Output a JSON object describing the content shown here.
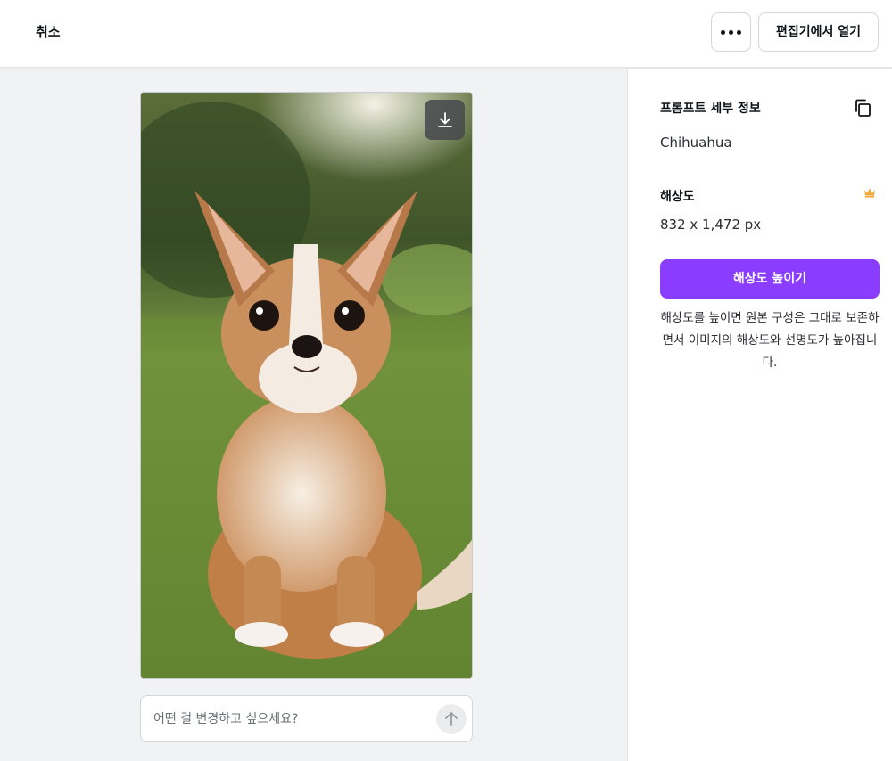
{
  "topbar": {
    "cancel_label": "취소",
    "more_icon": "more-horizontal-icon",
    "open_editor_label": "편집기에서 열기"
  },
  "canvas": {
    "image_subject": "Chihuahua",
    "download_icon": "download-icon",
    "prompt": {
      "placeholder": "어떤 걸 변경하고 싶으세요?",
      "value": "",
      "send_icon": "arrow-up-icon"
    }
  },
  "panel": {
    "prompt_details_title": "프롬프트 세부 정보",
    "prompt_text": "Chihuahua",
    "copy_icon": "copy-icon",
    "resolution_title": "해상도",
    "resolution_value": "832 x 1,472 px",
    "premium_icon": "crown-icon",
    "upscale_button_label": "해상도 높이기",
    "upscale_description": "해상도를 높이면 원본 구성은 그대로 보존하면서 이미지의 해상도와 선명도가 높아집니다."
  },
  "colors": {
    "accent": "#8b3dff",
    "crown": "#f0a93a",
    "canvas_bg": "#f1f2f4"
  }
}
